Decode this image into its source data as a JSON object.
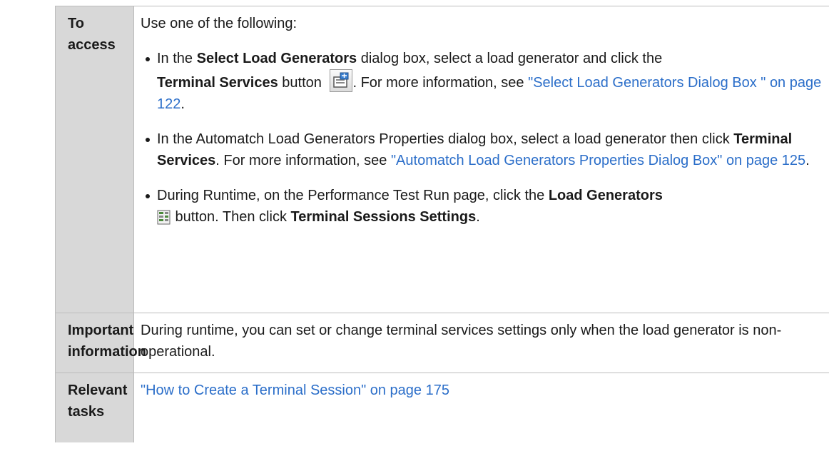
{
  "rows": [
    {
      "header": "To access"
    },
    {
      "header_line1": "Important",
      "header_line2": "information"
    },
    {
      "header_line1": "Relevant",
      "header_line2": "tasks"
    }
  ],
  "access": {
    "intro": "Use one of the following:",
    "item1": {
      "t1": "In the ",
      "b1": "Select Load Generators",
      "t2": " dialog box, select a load generator and click the",
      "b2": "Terminal Services",
      "t3": " button ",
      "icon": "terminal-services-icon",
      "t4": ". For more information, see ",
      "link": "\"Select Load Generators Dialog Box \" on page 122",
      "t5": "."
    },
    "item2": {
      "t1": "In the Automatch Load Generators Properties dialog box, select a load generator then click ",
      "b1": "Terminal Services",
      "t2": ". For more information, see ",
      "link": "\"Automatch Load Generators Properties Dialog Box\" on page 125",
      "t3": "."
    },
    "item3": {
      "t1": "During Runtime, on the Performance Test Run page, click the ",
      "b1": "Load Generators",
      "icon": "load-generators-icon",
      "t2": " button. Then click ",
      "b2": "Terminal Sessions Settings",
      "t3": "."
    }
  },
  "important": {
    "text": "During runtime, you can set or change terminal services settings only when the load generator is non-operational."
  },
  "tasks": {
    "link": "\"How to Create a Terminal Session\" on page 175"
  },
  "colors": {
    "header_bg": "#d8d8d8",
    "link": "#2b6ec9",
    "border": "#bcbcbc"
  }
}
